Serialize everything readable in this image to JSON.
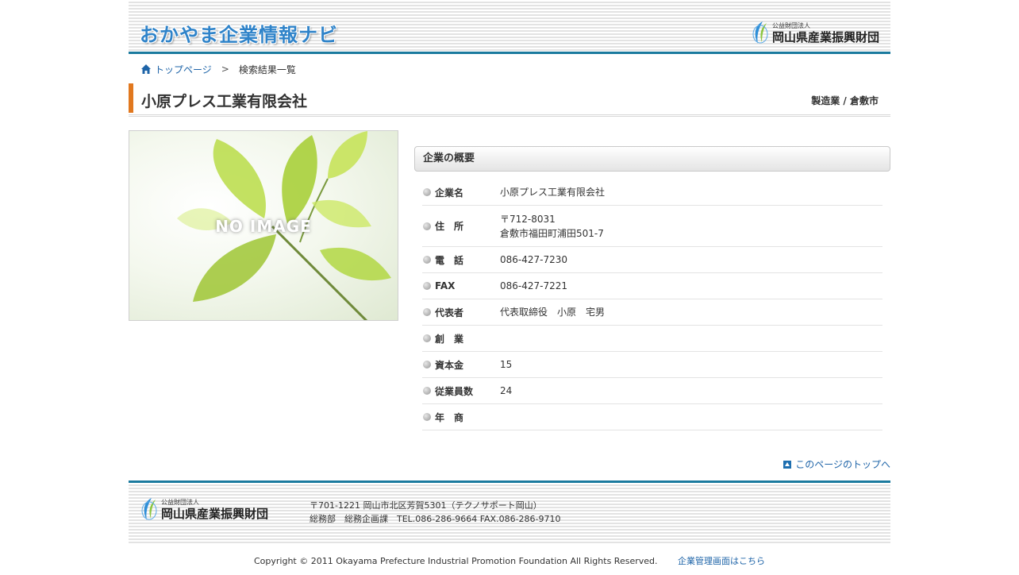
{
  "header": {
    "site_logo": "おかやま企業情報ナビ",
    "org_small": "公益財団法人",
    "org_name": "岡山県産業振興財団"
  },
  "breadcrumb": {
    "home": "トップページ",
    "separator": ">",
    "current": "検索結果一覧"
  },
  "company": {
    "name": "小原プレス工業有限会社",
    "category": "製造業 / 倉敷市"
  },
  "image": {
    "label": "NO IMAGE"
  },
  "overview": {
    "heading": "企業の概要",
    "rows": [
      {
        "label": "企業名",
        "value": "小原プレス工業有限会社"
      },
      {
        "label": "住　所",
        "value_line1": "〒712-8031",
        "value_line2": "倉敷市福田町浦田501-7"
      },
      {
        "label": "電　話",
        "value": "086-427-7230"
      },
      {
        "label": "FAX",
        "value": "086-427-7221"
      },
      {
        "label": "代表者",
        "value": "代表取締役　小原　宅男"
      },
      {
        "label": "創　業",
        "value": ""
      },
      {
        "label": "資本金",
        "value": "15"
      },
      {
        "label": "従業員数",
        "value": "24"
      },
      {
        "label": "年　商",
        "value": ""
      }
    ]
  },
  "pagetop": {
    "label": "このページのトップへ"
  },
  "footer": {
    "org_small": "公益財団法人",
    "org_name": "岡山県産業振興財団",
    "address": "〒701-1221 岡山市北区芳賀5301（テクノサポート岡山）",
    "contact": "総務部　総務企画課　TEL.086-286-9664 FAX.086-286-9710",
    "copyright": "Copyright © 2011 Okayama Prefecture Industrial Promotion Foundation All Rights Reserved.",
    "admin_link": "企業管理画面はこちら"
  },
  "colors": {
    "accent_blue": "#1a7a9e",
    "link_blue": "#1e64a8",
    "title_accent": "#e1781f"
  }
}
